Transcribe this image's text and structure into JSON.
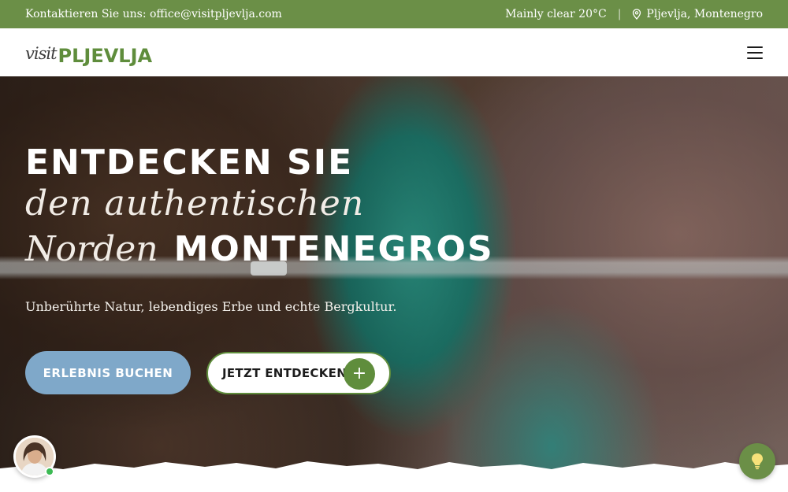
{
  "topbar": {
    "contact": "Kontaktieren Sie uns: office@visitpljevlja.com",
    "weather": "Mainly clear 20°C",
    "separator": "|",
    "location": "Pljevlja, Montenegro",
    "location_icon": "map-pin-icon"
  },
  "header": {
    "logo_script": "visit",
    "logo_name": "PLJEVLJA",
    "menu_icon": "hamburger-menu-icon"
  },
  "hero": {
    "line1": "ENTDECKEN SIE",
    "line2_script": "den authentischen",
    "line3_script": "Norden",
    "line3_caps": "MONTENEGROS",
    "subtitle": "Unberührte Natur, lebendiges Erbe und echte Bergkultur.",
    "btn_book": "ERLEBNIS BUCHEN",
    "btn_discover": "JETZT ENTDECKEN",
    "btn_discover_icon": "plus-icon"
  },
  "floating": {
    "chat_avatar_icon": "chat-avatar",
    "idea_icon": "lightbulb-icon"
  },
  "colors": {
    "brand_green": "#6b8f47",
    "logo_green": "#5f8d3c",
    "button_blue": "#7fa8c9"
  }
}
